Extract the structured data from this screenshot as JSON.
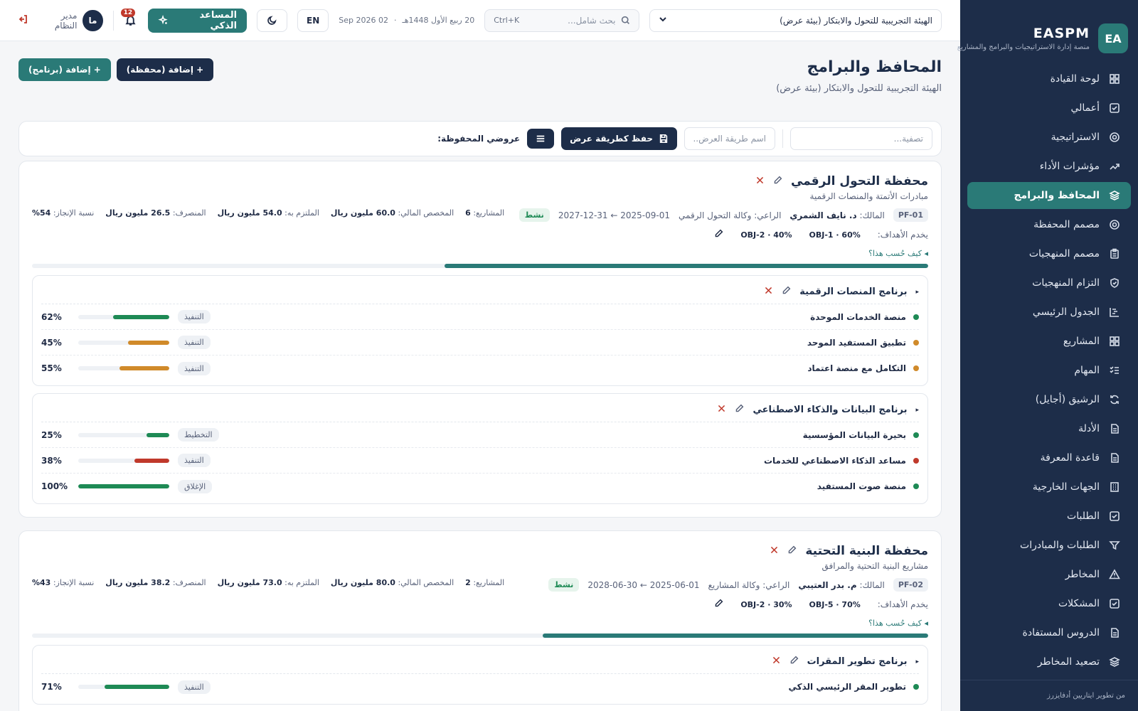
{
  "brand": {
    "logo": "EA",
    "title": "EASPM",
    "subtitle": "منصة إدارة الاستراتيجيات والبرامج والمشاريع"
  },
  "nav": [
    {
      "label": "لوحة القيادة",
      "icon": "dashboard-icon",
      "active": false
    },
    {
      "label": "أعمالي",
      "icon": "check-square-icon",
      "active": false
    },
    {
      "label": "الاستراتيجية",
      "icon": "target-icon",
      "active": false
    },
    {
      "label": "مؤشرات الأداء",
      "icon": "trend-icon",
      "active": false
    },
    {
      "label": "المحافظ والبرامج",
      "icon": "layers-icon",
      "active": true
    },
    {
      "label": "مصمم المحفظة",
      "icon": "target-icon",
      "active": false
    },
    {
      "label": "مصمم المنهجيات",
      "icon": "clipboard-icon",
      "active": false
    },
    {
      "label": "التزام المنهجيات",
      "icon": "shield-icon",
      "active": false
    },
    {
      "label": "الجدول الرئيسي",
      "icon": "gantt-icon",
      "active": false
    },
    {
      "label": "المشاريع",
      "icon": "grid-icon",
      "active": false
    },
    {
      "label": "المهام",
      "icon": "list-check-icon",
      "active": false
    },
    {
      "label": "الرشيق (أجايل)",
      "icon": "refresh-icon",
      "active": false
    },
    {
      "label": "الأدلة",
      "icon": "file-icon",
      "active": false
    },
    {
      "label": "قاعدة المعرفة",
      "icon": "file-icon",
      "active": false
    },
    {
      "label": "الجهات الخارجية",
      "icon": "building-icon",
      "active": false
    },
    {
      "label": "الطلبات",
      "icon": "check-square-icon",
      "active": false
    },
    {
      "label": "الطلبات والمبادرات",
      "icon": "filter-icon",
      "active": false
    },
    {
      "label": "المخاطر",
      "icon": "warning-icon",
      "active": false
    },
    {
      "label": "المشكلات",
      "icon": "check-square-icon",
      "active": false
    },
    {
      "label": "الدروس المستفادة",
      "icon": "file-icon",
      "active": false
    },
    {
      "label": "تصعيد المخاطر",
      "icon": "layers-icon",
      "active": false
    }
  ],
  "sidebar_footer": "من تطوير ايتاريين أدفايزرز",
  "topbar": {
    "org": "الهيئة التجريبية للتحول والابتكار (بيئة عرض)",
    "search_placeholder": "بحث شامل...",
    "search_kbd": "Ctrl+K",
    "hijri_date": "20 ربيع الأول 1448هـ",
    "date_sep": "·",
    "greg_date": "02 Sep 2026",
    "lang": "EN",
    "ai_label": "المساعد الذكي",
    "notif_count": "12",
    "user_initials": "ما",
    "user_role": "مدير النظام"
  },
  "page": {
    "title": "المحافظ والبرامج",
    "subtitle": "الهيئة التجريبية للتحول والابتكار (بيئة عرض)",
    "add_portfolio": "+ إضافة (محفظة)",
    "add_program": "+ إضافة (برنامج)"
  },
  "filter": {
    "filter_placeholder": "تصفية...",
    "view_name_placeholder": "اسم طريقة العرض...",
    "save_view": "حفظ كطريقة عرض",
    "saved_views": "عروضي المحفوظة:"
  },
  "colors": {
    "teal": "#2a7a77",
    "navy": "#1d2d49",
    "green": "#1e8a55",
    "orange": "#d08a2a",
    "red": "#c0392b"
  },
  "portfolios": [
    {
      "title": "محفظة التحول الرقمي",
      "desc": "مبادرات الأتمتة والمنصات الرقمية",
      "code": "PF-01",
      "owner_label": "المالك:",
      "owner": "د. نايف الشمري",
      "sponsor": "الراعي: وكالة التحول الرقمي",
      "dates": "2025-09-01 ← 2027-12-31",
      "status": "نشط",
      "objectives_label": "يخدم الأهداف:",
      "objectives": [
        "OBJ-1 · 60%",
        "OBJ-2 · 40%"
      ],
      "how_link": "◂ كيف حُسب هذا؟",
      "stats": {
        "projects_label": "المشاريع:",
        "projects": "6",
        "budget_label": "المخصص المالي:",
        "budget": "60.0 مليون ريال",
        "committed_label": "الملتزم به:",
        "committed": "54.0 مليون ريال",
        "spent_label": "المنصرف:",
        "spent": "26.5 مليون ريال",
        "progress_label": "نسبة الإنجاز:",
        "progress_text": "54%"
      },
      "progress": 0.54,
      "programs": [
        {
          "title": "برنامج المنصات الرقمية",
          "projects": [
            {
              "name": "منصة الخدمات الموحدة",
              "dot": "#1e8a55",
              "phase": "التنفيذ",
              "pct": 62,
              "pct_text": "62%",
              "bar": "#1e8a55"
            },
            {
              "name": "تطبيق المستفيد الموحد",
              "dot": "#d08a2a",
              "phase": "التنفيذ",
              "pct": 45,
              "pct_text": "45%",
              "bar": "#d08a2a"
            },
            {
              "name": "التكامل مع منصة اعتماد",
              "dot": "#d08a2a",
              "phase": "التنفيذ",
              "pct": 55,
              "pct_text": "55%",
              "bar": "#d08a2a"
            }
          ]
        },
        {
          "title": "برنامج البيانات والذكاء الاصطناعي",
          "projects": [
            {
              "name": "بحيرة البيانات المؤسسية",
              "dot": "#1e8a55",
              "phase": "التخطيط",
              "pct": 25,
              "pct_text": "25%",
              "bar": "#1e8a55"
            },
            {
              "name": "مساعد الذكاء الاصطناعي للخدمات",
              "dot": "#c0392b",
              "phase": "التنفيذ",
              "pct": 38,
              "pct_text": "38%",
              "bar": "#c0392b"
            },
            {
              "name": "منصة صوت المستفيد",
              "dot": "#1e8a55",
              "phase": "الإغلاق",
              "pct": 100,
              "pct_text": "100%",
              "bar": "#1e8a55"
            }
          ]
        }
      ]
    },
    {
      "title": "محفظة البنية التحتية",
      "desc": "مشاريع البنية التحتية والمرافق",
      "code": "PF-02",
      "owner_label": "المالك:",
      "owner": "م. بدر العتيبي",
      "sponsor": "الراعي: وكالة المشاريع",
      "dates": "2025-06-01 ← 2028-06-30",
      "status": "نشط",
      "objectives_label": "يخدم الأهداف:",
      "objectives": [
        "OBJ-5 · 70%",
        "OBJ-2 · 30%"
      ],
      "how_link": "◂ كيف حُسب هذا؟",
      "stats": {
        "projects_label": "المشاريع:",
        "projects": "2",
        "budget_label": "المخصص المالي:",
        "budget": "80.0 مليون ريال",
        "committed_label": "الملتزم به:",
        "committed": "73.0 مليون ريال",
        "spent_label": "المنصرف:",
        "spent": "38.2 مليون ريال",
        "progress_label": "نسبة الإنجاز:",
        "progress_text": "43%"
      },
      "progress": 0.43,
      "programs": [
        {
          "title": "برنامج تطوير المقرات",
          "projects": [
            {
              "name": "تطوير المقر الرئيسي الذكي",
              "dot": "#1e8a55",
              "phase": "التنفيذ",
              "pct": 71,
              "pct_text": "71%",
              "bar": "#1e8a55"
            }
          ]
        }
      ]
    }
  ]
}
